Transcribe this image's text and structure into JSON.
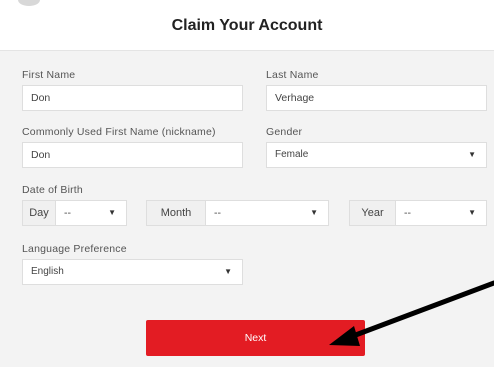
{
  "header": {
    "title": "Claim Your Account"
  },
  "form": {
    "first_name": {
      "label": "First Name",
      "value": "Don"
    },
    "last_name": {
      "label": "Last Name",
      "value": "Verhage"
    },
    "nickname": {
      "label": "Commonly Used First Name (nickname)",
      "value": "Don"
    },
    "gender": {
      "label": "Gender",
      "value": "Female"
    },
    "dob": {
      "label": "Date of Birth",
      "day_label": "Day",
      "day_value": "--",
      "month_label": "Month",
      "month_value": "--",
      "year_label": "Year",
      "year_value": "--"
    },
    "language": {
      "label": "Language Preference",
      "value": "English"
    }
  },
  "buttons": {
    "next": "Next"
  },
  "icons": {
    "caret": "▼"
  },
  "colors": {
    "accent": "#e31c23",
    "arrow": "#000000"
  }
}
